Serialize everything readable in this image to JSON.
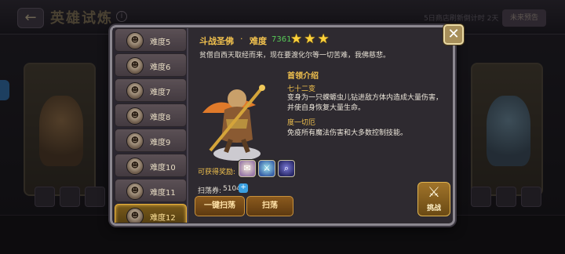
{
  "background": {
    "title": "英雄试炼",
    "note": "5日商店刷新倒计时 2天",
    "right_button": "未来预告"
  },
  "dialog": {
    "levels": [
      {
        "label": "难度5",
        "selected": false
      },
      {
        "label": "难度6",
        "selected": false
      },
      {
        "label": "难度7",
        "selected": false
      },
      {
        "label": "难度8",
        "selected": false
      },
      {
        "label": "难度9",
        "selected": false
      },
      {
        "label": "难度10",
        "selected": false
      },
      {
        "label": "难度11",
        "selected": false
      },
      {
        "label": "难度12",
        "selected": true
      }
    ],
    "hero": {
      "name": "斗战圣佛",
      "separator": "·",
      "difficulty": "难度",
      "power": "7361",
      "stars": 3,
      "stars_text": "★★★",
      "intro": "贫僧自西天取经而来，现在要渡化尔等一切苦难，我佛慈悲。"
    },
    "skills": {
      "heading": "首领介绍",
      "skill1_name": "七十二变",
      "skill1_desc": "变身为一只蝾螈虫儿钻进敌方体内造成大量伤害，并使自身恢复大量生命。",
      "skill2_name": "度一切厄",
      "skill2_desc": "免疫所有魔法伤害和大多数控制技能。"
    },
    "rewards": {
      "label": "可获得奖励:",
      "items": [
        "scroll-icon",
        "sword-icon",
        "magnifier-icon"
      ]
    },
    "sweep": {
      "label": "扫荡券:",
      "value": "5104",
      "plus": "+"
    },
    "buttons": {
      "sweep_all": "一键扫荡",
      "sweep": "扫荡",
      "challenge": "挑战",
      "close": "✕"
    }
  }
}
